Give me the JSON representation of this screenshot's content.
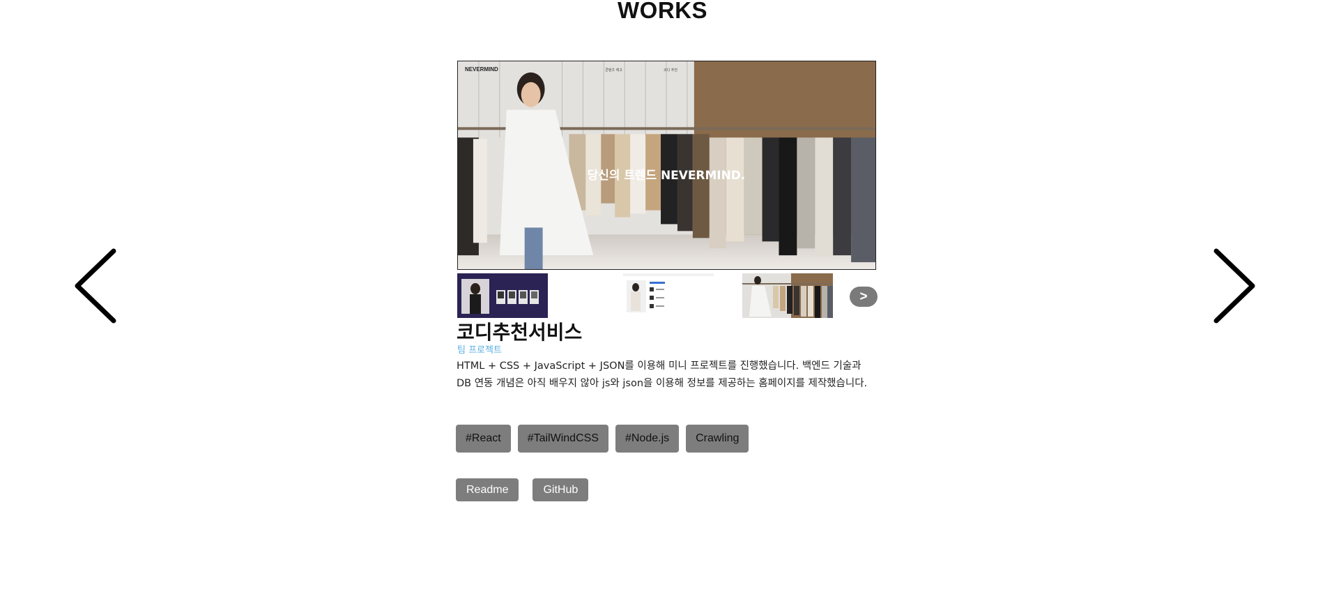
{
  "section": {
    "title": "WORKS"
  },
  "navigation": {
    "prev_icon": "chevron-left-icon",
    "next_icon": "chevron-right-icon"
  },
  "preview": {
    "brand": "NEVERMIND",
    "menu_items": [
      "콘텐츠 재고",
      "코디 추천"
    ],
    "headline": "당신의 트렌드 NEVERMIND."
  },
  "thumbnails": {
    "next_label": ">"
  },
  "project": {
    "title": "코디추천서비스",
    "type": "팀 프로젝트",
    "description": "HTML + CSS + JavaScript + JSON를 이용해 미니 프로젝트를 진행했습니다. 백엔드 기술과 DB 연동 개념은 아직 배우지 않아 js와 json을 이용해 정보를 제공하는 홈페이지를 제작했습니다.",
    "tags": [
      "#React",
      "#TailWindCSS",
      "#Node.js",
      "Crawling"
    ],
    "links": {
      "readme": "Readme",
      "github": "GitHub"
    }
  },
  "colors": {
    "accent_text": "#5aaee0",
    "button_bg": "#7d7d7d"
  }
}
